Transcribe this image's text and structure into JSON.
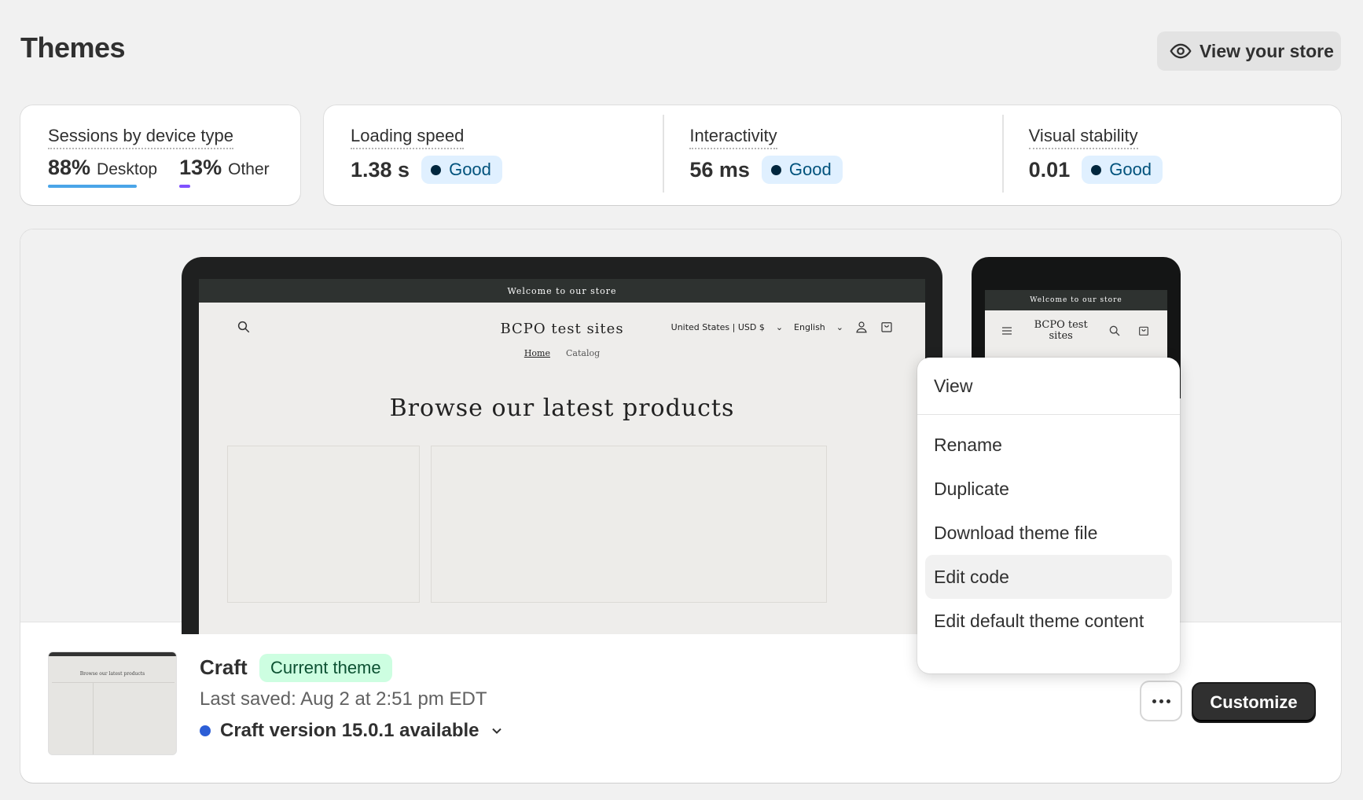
{
  "header": {
    "title": "Themes",
    "view_store_label": "View your store"
  },
  "sessions": {
    "label": "Sessions by device type",
    "items": [
      {
        "pct": "88%",
        "name": "Desktop",
        "color": "#4aa5e8",
        "fraction": 0.88
      },
      {
        "pct": "13%",
        "name": "Other",
        "color": "#8051ff",
        "fraction": 0.13
      }
    ]
  },
  "metrics": [
    {
      "label": "Loading speed",
      "value": "1.38 s",
      "status": "Good"
    },
    {
      "label": "Interactivity",
      "value": "56 ms",
      "status": "Good"
    },
    {
      "label": "Visual stability",
      "value": "0.01",
      "status": "Good"
    }
  ],
  "preview": {
    "announcement": "Welcome to our store",
    "store_name": "BCPO test sites",
    "currency": "United States | USD $",
    "language": "English",
    "nav": [
      "Home",
      "Catalog"
    ],
    "hero": "Browse our latest products",
    "mobile_store_name": "BCPO test sites"
  },
  "theme": {
    "name": "Craft",
    "badge": "Current theme",
    "last_saved": "Last saved: Aug 2 at 2:51 pm EDT",
    "version_notice": "Craft version 15.0.1 available",
    "thumb_hero": "Browse our latest products",
    "customize_label": "Customize"
  },
  "menu": {
    "items": [
      "View",
      "Rename",
      "Duplicate",
      "Download theme file",
      "Edit code",
      "Edit default theme content"
    ],
    "highlighted": "Edit code"
  }
}
